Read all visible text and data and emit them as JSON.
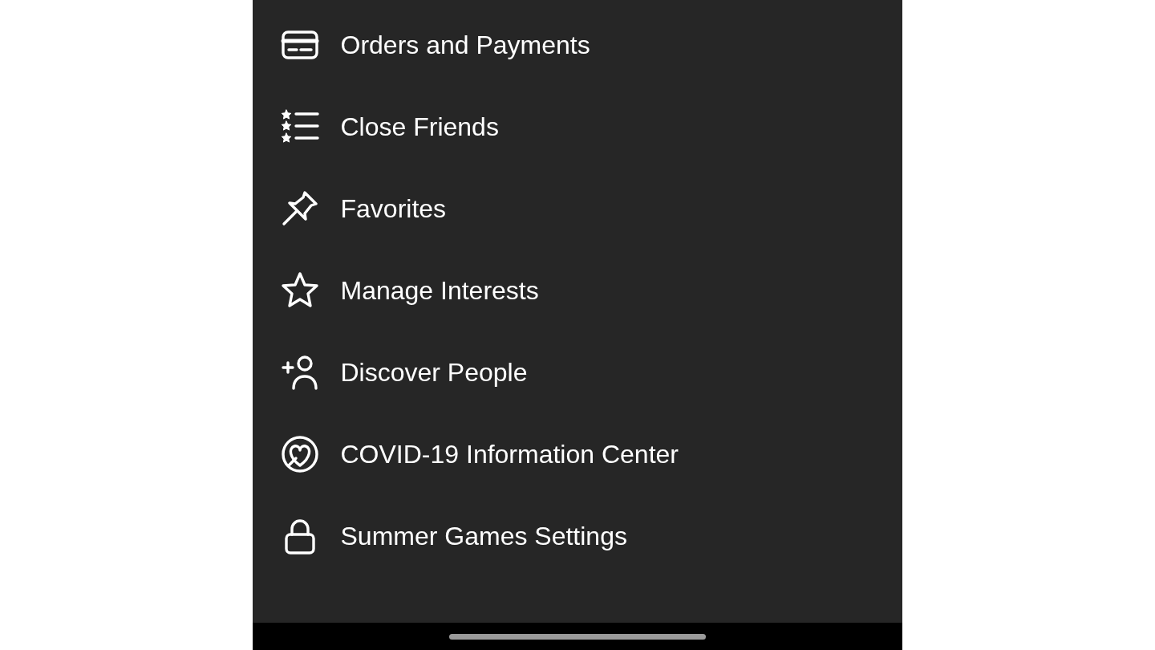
{
  "menu": {
    "items": [
      {
        "label": "Orders and Payments"
      },
      {
        "label": "Close Friends"
      },
      {
        "label": "Favorites"
      },
      {
        "label": "Manage Interests"
      },
      {
        "label": "Discover People"
      },
      {
        "label": "COVID-19 Information Center"
      },
      {
        "label": "Summer Games Settings"
      }
    ]
  }
}
